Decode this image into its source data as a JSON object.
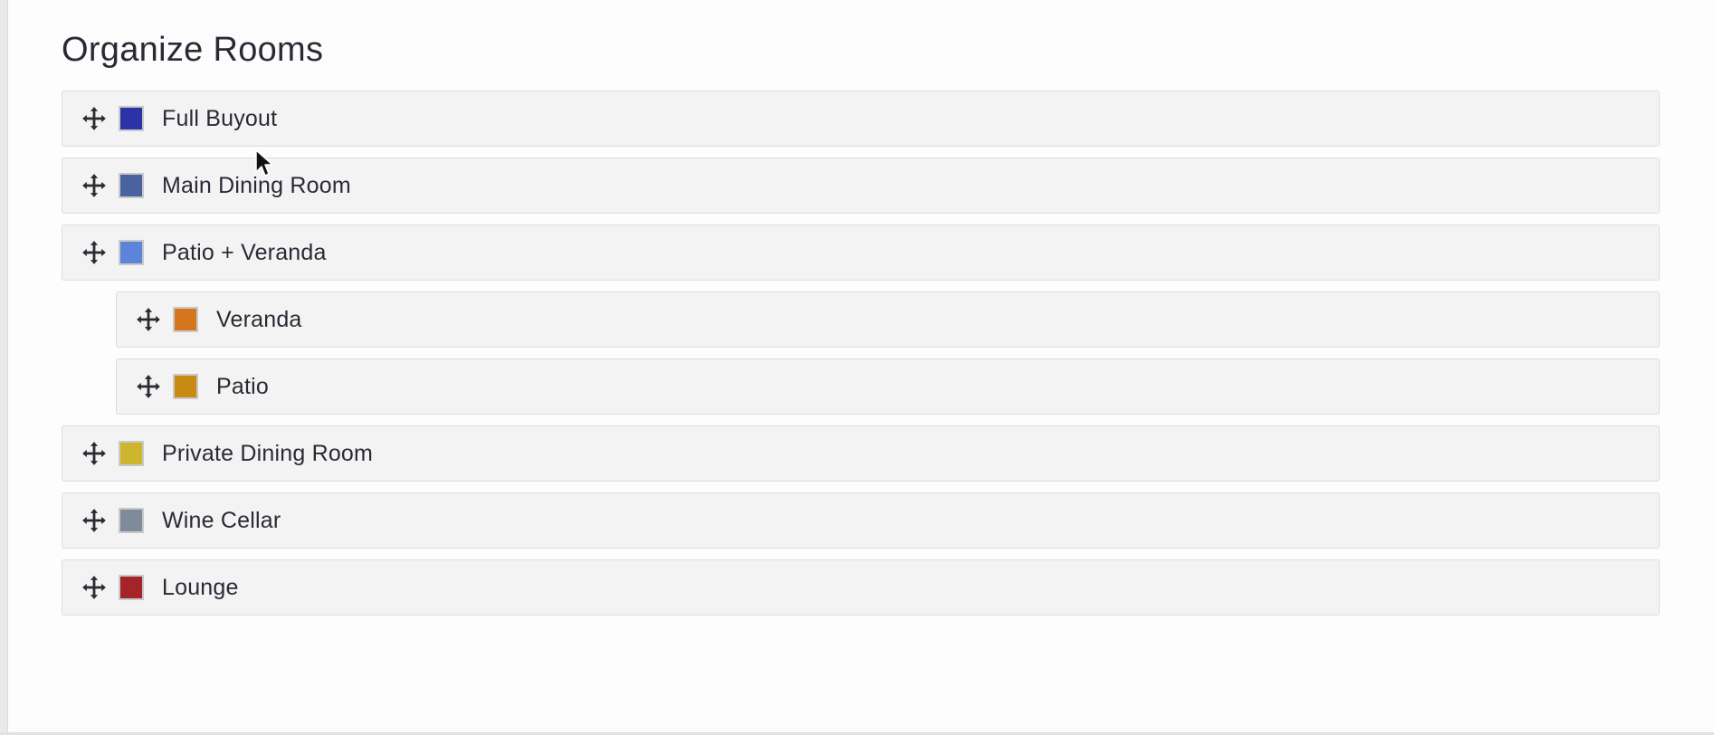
{
  "page": {
    "title": "Organize Rooms"
  },
  "icons": {
    "drag": "move-arrows-icon",
    "cursor": "mouse-pointer-icon"
  },
  "rooms": [
    {
      "label": "Full Buyout",
      "color": "#2b33a6",
      "level": 0
    },
    {
      "label": "Main Dining Room",
      "color": "#4a62a0",
      "level": 0
    },
    {
      "label": "Patio + Veranda",
      "color": "#5b85d9",
      "level": 0
    },
    {
      "label": "Veranda",
      "color": "#d4761e",
      "level": 1
    },
    {
      "label": "Patio",
      "color": "#c98a12",
      "level": 1
    },
    {
      "label": "Private Dining Room",
      "color": "#cdb52e",
      "level": 0
    },
    {
      "label": "Wine Cellar",
      "color": "#7f8b9a",
      "level": 0
    },
    {
      "label": "Lounge",
      "color": "#a42429",
      "level": 0
    }
  ]
}
